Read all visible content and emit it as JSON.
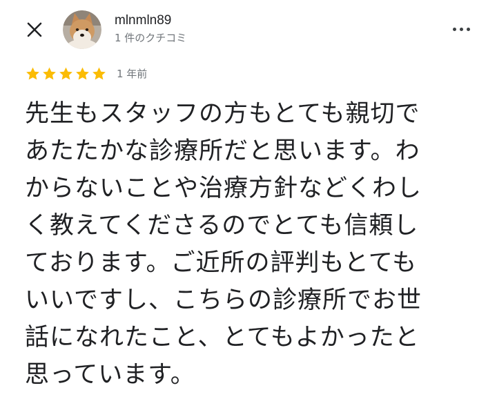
{
  "header": {
    "close_icon": "close-icon",
    "more_icon": "more-vert-icon"
  },
  "user": {
    "name": "mlnmln89",
    "review_count": "1 件のクチコミ",
    "avatar": "shiba-dog-photo"
  },
  "review": {
    "rating": 5,
    "max_rating": 5,
    "star_color": "#fbbc04",
    "date": "1 年前",
    "text": "先生もスタッフの方もとても親切で\nあたたかな診療所だと思います。わ\nからないことや治療方針などくわし\nく教えてくださるのでとても信頼し\nております。ご近所の評判もとても\nいいですし、こちらの診療所でお世\n話になれたこと、とてもよかったと\n思っています。"
  }
}
